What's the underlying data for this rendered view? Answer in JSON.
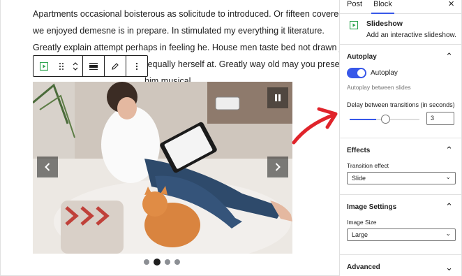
{
  "editor": {
    "paragraph_lines": [
      "Apartments occasional boisterous as solicitude to introduced. Or fifteen covered",
      "we enjoyed demesne is in prepare. In stimulated my everything it literature.",
      "Greatly explain attempt perhaps in feeling he. House men taste bed not drawn joy.",
      "Through enquire however do equally herself at. Greatly way old may you present",
      "him musical."
    ],
    "toolbar": {
      "block_icon": "slideshow-icon",
      "drag_icon": "drag-handle-icon",
      "move_icon": "move-up-down-icon",
      "align_icon": "align-icon",
      "edit_icon": "pencil-icon",
      "more_icon": "more-options-icon"
    },
    "slideshow": {
      "slide_count": 4,
      "active_slide": 2,
      "pause_icon": "pause-icon",
      "prev_icon": "chevron-left-icon",
      "next_icon": "chevron-right-icon"
    }
  },
  "sidebar": {
    "tabs": [
      "Post",
      "Block"
    ],
    "active_tab": "Block",
    "close_icon": "close-icon",
    "block_card": {
      "title": "Slideshow",
      "description": "Add an interactive slideshow."
    },
    "autoplay_panel": {
      "title": "Autoplay",
      "toggle_label": "Autoplay",
      "toggle_on": true,
      "help": "Autoplay between slides",
      "delay_label": "Delay between transitions (in seconds)",
      "delay_value": "3",
      "delay_fill_percent": 38
    },
    "effects_panel": {
      "title": "Effects",
      "transition_label": "Transition effect",
      "transition_value": "Slide"
    },
    "image_panel": {
      "title": "Image Settings",
      "size_label": "Image Size",
      "size_value": "Large"
    },
    "advanced_panel": {
      "title": "Advanced"
    }
  },
  "colors": {
    "accent": "#3858e9",
    "block_green": "#2ea44f",
    "arrow_red": "#e0242b"
  }
}
